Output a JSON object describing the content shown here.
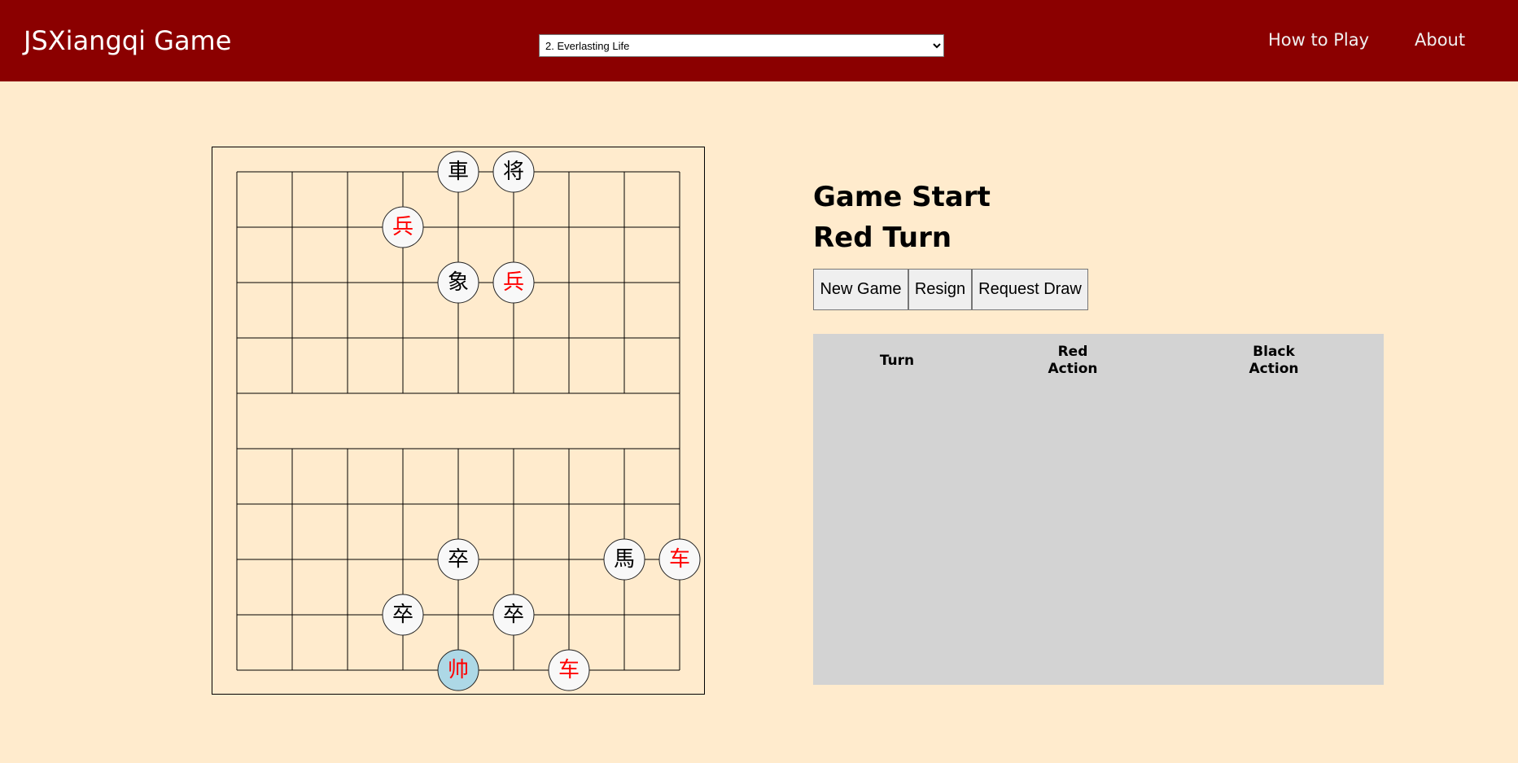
{
  "app": {
    "title": "JSXiangqi Game"
  },
  "nav": {
    "puzzle_selected": "2. Everlasting Life",
    "how_to_play": "How to Play",
    "about": "About"
  },
  "status": {
    "title": "Game Start",
    "turn": "Red Turn"
  },
  "buttons": {
    "new_game": "New Game",
    "resign": "Resign",
    "request_draw": "Request Draw"
  },
  "history": {
    "headers": [
      "Turn",
      "Red\nAction",
      "Black\nAction"
    ],
    "rows": []
  },
  "colors": {
    "header_bg": "#8b0000",
    "page_bg": "#ffebcd",
    "red_piece": "#ff0000",
    "black_piece": "#000000",
    "selected_piece": "#add8e6",
    "history_bg": "#d3d3d3"
  },
  "board": {
    "files": 9,
    "ranks": 10,
    "pieces": [
      {
        "char": "車",
        "side": "black",
        "name": "chariot",
        "file": 4,
        "rank": 0
      },
      {
        "char": "将",
        "side": "black",
        "name": "general",
        "file": 5,
        "rank": 0
      },
      {
        "char": "兵",
        "side": "red",
        "name": "soldier",
        "file": 3,
        "rank": 1
      },
      {
        "char": "象",
        "side": "black",
        "name": "elephant",
        "file": 4,
        "rank": 2
      },
      {
        "char": "兵",
        "side": "red",
        "name": "soldier",
        "file": 5,
        "rank": 2
      },
      {
        "char": "卒",
        "side": "black",
        "name": "soldier",
        "file": 4,
        "rank": 7
      },
      {
        "char": "馬",
        "side": "black",
        "name": "horse",
        "file": 7,
        "rank": 7
      },
      {
        "char": "车",
        "side": "red",
        "name": "chariot",
        "file": 8,
        "rank": 7
      },
      {
        "char": "卒",
        "side": "black",
        "name": "soldier",
        "file": 3,
        "rank": 8
      },
      {
        "char": "卒",
        "side": "black",
        "name": "soldier",
        "file": 5,
        "rank": 8
      },
      {
        "char": "帅",
        "side": "red",
        "name": "general",
        "file": 4,
        "rank": 9,
        "selected": true
      },
      {
        "char": "车",
        "side": "red",
        "name": "chariot",
        "file": 6,
        "rank": 9
      }
    ]
  }
}
